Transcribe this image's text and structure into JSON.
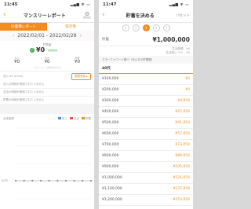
{
  "left": {
    "status": {
      "time": "11:45",
      "signal": "▂▄▆ ᯤ ▭"
    },
    "header": {
      "back": "‹",
      "title": "マンスリーレポート",
      "gear_label": "⚙",
      "gear_caption": "目標設定"
    },
    "tabs": [
      "貯蓄簿レポート",
      "家計簿"
    ],
    "period": {
      "prev": "‹",
      "range": "2022/02/01 - 2022/02/28",
      "next": "›"
    },
    "summary": {
      "label": "貯蓄額",
      "amount": "¥0",
      "note": "目標達成",
      "columns": [
        {
          "label": "収入",
          "value": "¥0"
        },
        {
          "label": "支出",
          "value": "¥0"
        },
        {
          "label": "貯蓄",
          "value": "¥0"
        }
      ],
      "hint": "スライドして各期間を見る"
    },
    "income": {
      "text": "収入 ¥0 (0.0%)",
      "button": "履歴登録 ▸"
    },
    "rows": [
      "収入の明細が登録されていません",
      "支出の明細が登録されていません",
      "貯蓄の明細が登録されていません"
    ],
    "trend": {
      "title": "全体推移",
      "legend": [
        {
          "name": "収入",
          "color": "#4a90d9"
        },
        {
          "name": "支出",
          "color": "#e5535a"
        },
        {
          "name": "貯蓄",
          "color": "#f28c1e"
        }
      ],
      "y_label": "¥0万"
    }
  },
  "chart_data": {
    "type": "line",
    "title": "全体推移",
    "x": [
      "1",
      "2",
      "3",
      "4",
      "5",
      "6",
      "7",
      "8",
      "9",
      "10"
    ],
    "series": [
      {
        "name": "貯蓄",
        "values": [
          0,
          0,
          0,
          0,
          0,
          0,
          0,
          0,
          0,
          0
        ]
      }
    ],
    "ylabel": "¥0万",
    "grid": true
  },
  "right": {
    "status": {
      "time": "11:47",
      "signal": "▂▄▆ ᯤ ▭"
    },
    "header": {
      "back": "‹",
      "title": "貯蓄を決める",
      "reset": "リセット"
    },
    "steps": [
      "1",
      "2",
      "3",
      "4",
      "5"
    ],
    "target": {
      "label": "貯蓄",
      "value": "¥1,000,000"
    },
    "info": [
      {
        "label": "生活費額",
        "value": "¥0"
      },
      {
        "label": "生活費/レベル",
        "value": "¥0"
      }
    ],
    "hint": "マネーフォワード調べ（みんなの貯蓄額）",
    "age_group": "40代",
    "table": [
      {
        "amount": "¥100,000",
        "monthly": "¥0"
      },
      {
        "amount": "¥200,000",
        "monthly": "¥0"
      },
      {
        "amount": "¥300,000",
        "monthly": "¥9,054"
      },
      {
        "amount": "¥400,000",
        "monthly": "¥25,054"
      },
      {
        "amount": "¥500,000",
        "monthly": "¥41,054"
      },
      {
        "amount": "¥600,000",
        "monthly": "¥57,054"
      },
      {
        "amount": "¥700,000",
        "monthly": "¥73,054"
      },
      {
        "amount": "¥800,000",
        "monthly": "¥89,054"
      },
      {
        "amount": "¥900,000",
        "monthly": "¥105,054"
      },
      {
        "amount": "¥1,000,000",
        "monthly": "¥121,054"
      },
      {
        "amount": "¥1,100,000",
        "monthly": "¥137,054"
      },
      {
        "amount": "¥1,200,000",
        "monthly": "¥153,054"
      }
    ]
  }
}
